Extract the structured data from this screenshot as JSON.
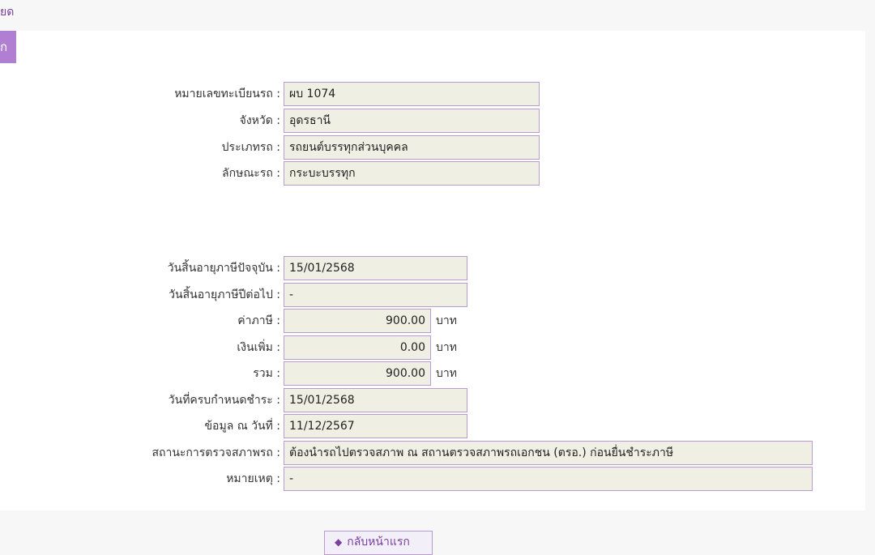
{
  "top": {
    "link_text": "ยด"
  },
  "tab": {
    "label": "ก"
  },
  "vehicle": [
    {
      "label": "หมายเลขทะเบียนรถ :",
      "value": "ผบ 1074"
    },
    {
      "label": "จังหวัด :",
      "value": "อุดรธานี"
    },
    {
      "label": "ประเภทรถ :",
      "value": "รถยนต์บรรทุกส่วนบุคคล"
    },
    {
      "label": "ลักษณะรถ :",
      "value": "กระบะบรรทุก"
    }
  ],
  "tax": {
    "expire_current": {
      "label": "วันสิ้นอายุภาษีปัจจุบัน :",
      "value": "15/01/2568"
    },
    "expire_next": {
      "label": "วันสิ้นอายุภาษีปีต่อไป :",
      "value": "-"
    },
    "tax_amount": {
      "label": "ค่าภาษี :",
      "value": "900.00",
      "unit": "บาท"
    },
    "surcharge": {
      "label": "เงินเพิ่ม :",
      "value": "0.00",
      "unit": "บาท"
    },
    "total": {
      "label": "รวม :",
      "value": "900.00",
      "unit": "บาท"
    },
    "due_date": {
      "label": "วันที่ครบกำหนดชำระ :",
      "value": "15/01/2568"
    },
    "data_as_of": {
      "label": "ข้อมูล ณ วันที่ :",
      "value": "11/12/2567"
    },
    "inspection_status": {
      "label": "สถานะการตรวจสภาพรถ :",
      "value": "ต้องนำรถไปตรวจสภาพ ณ สถานตรวจสภาพรถเอกชน (ตรอ.) ก่อนยื่นชำระภาษี"
    },
    "remark": {
      "label": "หมายเหตุ :",
      "value": "-"
    }
  },
  "footer": {
    "back_label": "กลับหน้าแรก",
    "back_icon": "diamond-icon"
  }
}
